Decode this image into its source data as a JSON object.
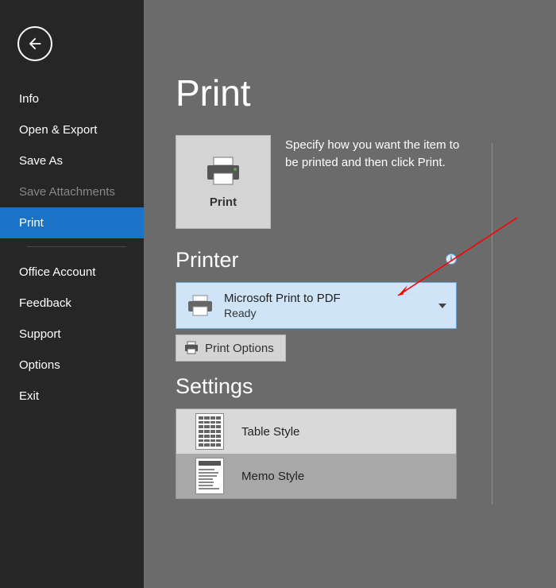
{
  "sidebar": {
    "items": [
      {
        "label": "Info"
      },
      {
        "label": "Open & Export"
      },
      {
        "label": "Save As"
      },
      {
        "label": "Save Attachments",
        "muted": true
      },
      {
        "label": "Print",
        "active": true
      }
    ],
    "items2": [
      {
        "label": "Office Account"
      },
      {
        "label": "Feedback"
      },
      {
        "label": "Support"
      },
      {
        "label": "Options"
      },
      {
        "label": "Exit"
      }
    ]
  },
  "page": {
    "title": "Print",
    "print_button_label": "Print",
    "description": "Specify how you want the item to be printed and then click Print."
  },
  "printer_section": {
    "heading": "Printer",
    "selected_name": "Microsoft Print to PDF",
    "selected_status": "Ready",
    "options_button": "Print Options"
  },
  "settings_section": {
    "heading": "Settings",
    "styles": [
      {
        "label": "Table Style",
        "selected": true,
        "kind": "table"
      },
      {
        "label": "Memo Style",
        "selected": false,
        "kind": "memo"
      }
    ]
  }
}
